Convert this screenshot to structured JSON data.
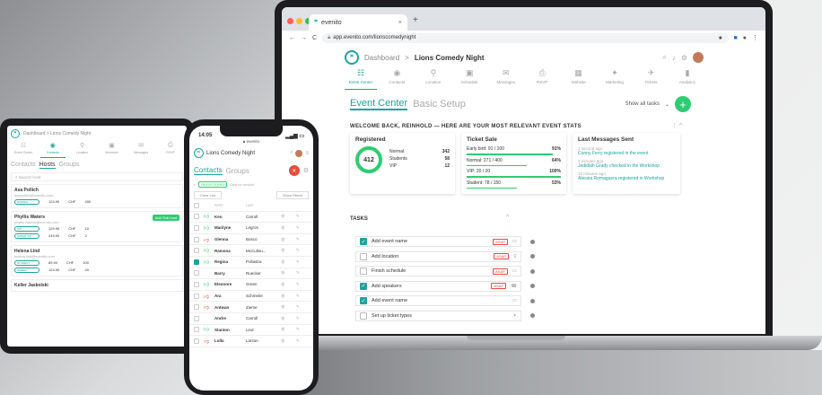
{
  "browser": {
    "tab_title": "evenito",
    "url": "app.evenito.com/lionscomedynight"
  },
  "app": {
    "breadcrumb_root": "Dashboard",
    "breadcrumb_sep": ">",
    "event_name": "Lions Comedy Night"
  },
  "nav": [
    {
      "label": "Event Center",
      "icon": "event-center-icon",
      "active": true
    },
    {
      "label": "Contacts",
      "icon": "contacts-icon"
    },
    {
      "label": "Location",
      "icon": "location-icon"
    },
    {
      "label": "Schedule",
      "icon": "schedule-icon"
    },
    {
      "label": "Messages",
      "icon": "messages-icon"
    },
    {
      "label": "RSVP",
      "icon": "rsvp-icon"
    },
    {
      "label": "Website",
      "icon": "website-icon"
    },
    {
      "label": "Marketing",
      "icon": "marketing-icon"
    },
    {
      "label": "Tickets",
      "icon": "tickets-icon"
    },
    {
      "label": "Analytics",
      "icon": "analytics-icon"
    }
  ],
  "main": {
    "tab_active": "Event Center",
    "tab_other": "Basic Setup",
    "show_all": "Show all tasks",
    "plus": "+",
    "welcome": "WELCOME BACK, REINHOLD — HERE ARE YOUR MOST RELEVANT EVENT STATS",
    "tasks_title": "TASKS"
  },
  "registered": {
    "title": "Registered",
    "total": "412",
    "rows": [
      {
        "label": "Normal",
        "value": "342"
      },
      {
        "label": "Students",
        "value": "58"
      },
      {
        "label": "VIP",
        "value": "12"
      }
    ]
  },
  "ticket_sale": {
    "title": "Ticket Sale",
    "rows": [
      {
        "label": "Early bird: 91 / 100",
        "pct": "91%",
        "fill": 0.91
      },
      {
        "label": "Normal: 271 / 400",
        "pct": "64%",
        "fill": 0.64
      },
      {
        "label": "VIP: 20 / 20",
        "pct": "100%",
        "fill": 1.0
      },
      {
        "label": "Student: 78 / 150",
        "pct": "53%",
        "fill": 0.53
      }
    ]
  },
  "messages": {
    "title": "Last Messages Sent",
    "items": [
      {
        "time": "1 second ago",
        "text": "Conny Ferry registered in the event"
      },
      {
        "time": "3 minutes ago",
        "text": "Jedidiah Grady checked in the Workshop"
      },
      {
        "time": "10 minutes ago",
        "text": "Alessia Romaguera registered in Workshop"
      }
    ]
  },
  "tasks": [
    {
      "label": "Add event name",
      "done": true,
      "asap": "ASAP"
    },
    {
      "label": "Add location",
      "done": false,
      "asap": "ASAP"
    },
    {
      "label": "Finish schedule",
      "done": false,
      "asap": "ASAP"
    },
    {
      "label": "Add speakers",
      "done": true,
      "asap": "ASAP"
    },
    {
      "label": "Add event name",
      "done": true,
      "asap": ""
    },
    {
      "label": "Set up ticket types",
      "done": false,
      "asap": ""
    }
  ],
  "tablet": {
    "breadcrumb": "Dashboard > Lions Comedy Night",
    "tabs": [
      "Contacts",
      "Hosts",
      "Groups"
    ],
    "search": "Search Host",
    "nav": [
      "Event Center",
      "Contacts",
      "Location",
      "Schedule",
      "Messages",
      "RSVP"
    ],
    "hosts": [
      {
        "name": "Asa Pollich",
        "email": "asapollich@evenito.com",
        "badge": "NORMAL",
        "price": "124.90",
        "cur": "CHF",
        "qty": "400"
      },
      {
        "name": "Phyllis Waters",
        "email": "phyllis.waters@evenito.com",
        "badge": "VIP",
        "price": "129.90",
        "cur": "CHF",
        "qty": "10",
        "badge2": "SUPER VIP",
        "price2": "249.90",
        "qty2": "2",
        "action": "Add Sub-host"
      },
      {
        "name": "Helena Lind",
        "email": "helena.lind@evenito.com",
        "badge": "STUDENT",
        "price": "89.90",
        "cur": "CHF",
        "qty": "100",
        "badge2": "GREEN",
        "price2": "124.90",
        "qty2": "40"
      },
      {
        "name": "Keller Jaskolski",
        "email": "",
        "badge": "",
        "price": "",
        "cur": "",
        "qty": ""
      }
    ]
  },
  "phone": {
    "time": "14:05",
    "url": "evenito",
    "title": "Lions Comedy Night",
    "tabs": [
      "Contacts",
      "Groups"
    ],
    "filter_tag": "REGISTERED",
    "search": "Search contact",
    "clear": "Clear List",
    "show_filters": "Show Filters",
    "col_first": "FIRST",
    "col_last": "LAST",
    "contacts": [
      {
        "first": "Ken",
        "last": "Carroll",
        "status": "up"
      },
      {
        "first": "Marilyne",
        "last": "Legros",
        "status": "up"
      },
      {
        "first": "Glenna",
        "last": "Bosco",
        "status": "down"
      },
      {
        "first": "Ramona",
        "last": "McCullou...",
        "status": "up"
      },
      {
        "first": "Regina",
        "last": "Pollastra",
        "status": "up",
        "checked": true
      },
      {
        "first": "Barry",
        "last": "Ruecker",
        "status": ""
      },
      {
        "first": "Eleonore",
        "last": "Green",
        "status": "up"
      },
      {
        "first": "Ara",
        "last": "Schmeler",
        "status": "down"
      },
      {
        "first": "Antwan",
        "last": "Zieme",
        "status": "down"
      },
      {
        "first": "Andre",
        "last": "Carroll",
        "status": ""
      },
      {
        "first": "Stanton",
        "last": "Lind",
        "status": "up"
      },
      {
        "first": "Lolla",
        "last": "Larson",
        "status": "down"
      }
    ]
  },
  "colors": {
    "accent": "#1ba39c",
    "green": "#2ecc71",
    "red": "#e74c3c"
  }
}
